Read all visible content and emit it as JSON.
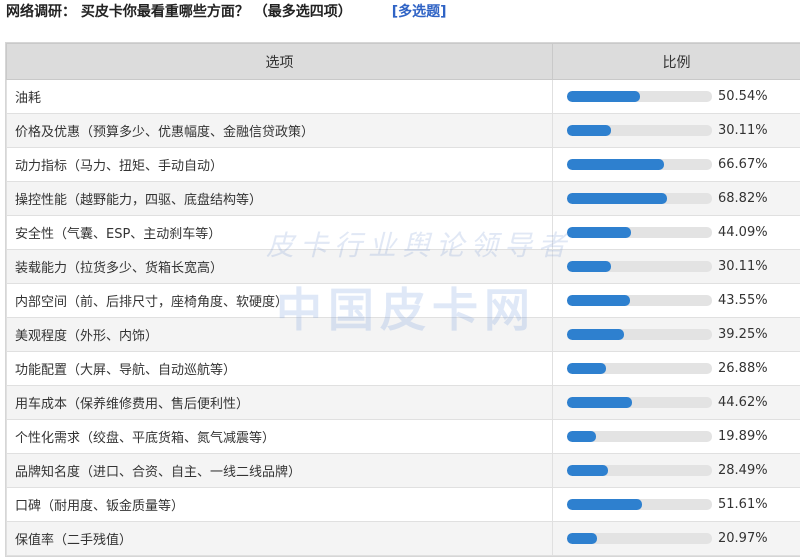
{
  "header": {
    "title": "网络调研： 买皮卡你最看重哪些方面？ （最多选四项）",
    "multi_select": "[多选题]"
  },
  "table": {
    "col_option": "选项",
    "col_ratio": "比例",
    "rows": [
      {
        "label": "油耗",
        "pct_text": "50.54%",
        "value": 50.54
      },
      {
        "label": "价格及优惠（预算多少、优惠幅度、金融信贷政策）",
        "pct_text": "30.11%",
        "value": 30.11
      },
      {
        "label": "动力指标（马力、扭矩、手动自动）",
        "pct_text": "66.67%",
        "value": 66.67
      },
      {
        "label": "操控性能（越野能力，四驱、底盘结构等）",
        "pct_text": "68.82%",
        "value": 68.82
      },
      {
        "label": "安全性（气囊、ESP、主动刹车等）",
        "pct_text": "44.09%",
        "value": 44.09
      },
      {
        "label": "装载能力（拉货多少、货箱长宽高）",
        "pct_text": "30.11%",
        "value": 30.11
      },
      {
        "label": "内部空间（前、后排尺寸，座椅角度、软硬度）",
        "pct_text": "43.55%",
        "value": 43.55
      },
      {
        "label": "美观程度（外形、内饰）",
        "pct_text": "39.25%",
        "value": 39.25
      },
      {
        "label": "功能配置（大屏、导航、自动巡航等）",
        "pct_text": "26.88%",
        "value": 26.88
      },
      {
        "label": "用车成本（保养维修费用、售后便利性）",
        "pct_text": "44.62%",
        "value": 44.62
      },
      {
        "label": "个性化需求（绞盘、平底货箱、氮气减震等）",
        "pct_text": "19.89%",
        "value": 19.89
      },
      {
        "label": "品牌知名度（进口、合资、自主、一线二线品牌）",
        "pct_text": "28.49%",
        "value": 28.49
      },
      {
        "label": "口碑（耐用度、钣金质量等）",
        "pct_text": "51.61%",
        "value": 51.61
      },
      {
        "label": "保值率（二手残值）",
        "pct_text": "20.97%",
        "value": 20.97
      }
    ]
  },
  "watermark": {
    "line1": "皮卡行业舆论领导者",
    "line2": "中国皮卡网"
  },
  "colors": {
    "bar_fill": "#2e80cf",
    "bar_track": "#e3e3e3",
    "header_bg": "#dcdcdc",
    "link": "#2f63c5"
  }
}
